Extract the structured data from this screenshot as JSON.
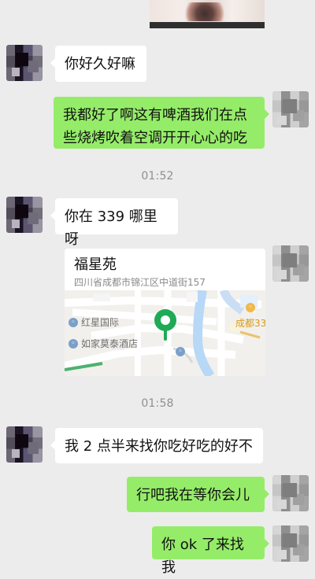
{
  "messages": [
    {
      "text": "你好久好嘛"
    },
    {
      "text": "我都好了啊这有啤酒我们在点\n些烧烤吹着空调开开心心的吃"
    },
    {
      "text": "你在 339 哪里呀"
    },
    {
      "text": "我 2 点半来找你吃好吃的好不"
    },
    {
      "text": "行吧我在等你会儿"
    },
    {
      "text": "你 ok 了来找我"
    }
  ],
  "timestamps": [
    "01:52",
    "01:58"
  ],
  "location": {
    "title": "福星苑",
    "address": "四川省成都市锦江区中道街157",
    "map_labels": [
      "红星国际",
      "如家莫泰酒店",
      "成都33"
    ]
  }
}
